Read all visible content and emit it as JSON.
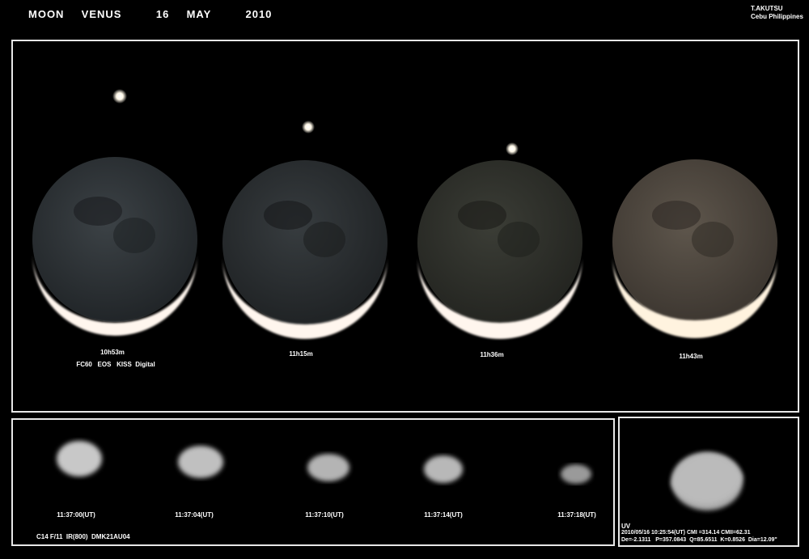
{
  "header": {
    "title": "MOON  VENUS    16  MAY    2010",
    "author": "T.AKUTSU",
    "location": "Cebu  Philippines"
  },
  "moon_panel": {
    "times": [
      "10h53m",
      "11h15m",
      "11h36m",
      "11h43m"
    ],
    "equipment": "FC60   EOS   KISS  Digital"
  },
  "venus_panel": {
    "times": [
      "11:37:00(UT)",
      "11:37:04(UT)",
      "11:37:10(UT)",
      "11:37:14(UT)",
      "11:37:18(UT)"
    ],
    "equipment": "C14 F/11  IR(800)  DMK21AU04"
  },
  "uv_panel": {
    "filter": "UV",
    "line1": "2010/05/16 10:25:54(UT) CMI =314.14 CMII=62.31",
    "line2": "De=-2.1311   P=357.0843  Q=85.6511  K=0.8526  Dia=12.09\""
  },
  "colors": {
    "frame": "#e8e8e8",
    "background": "#000000",
    "crescent": "#fff6ee"
  }
}
